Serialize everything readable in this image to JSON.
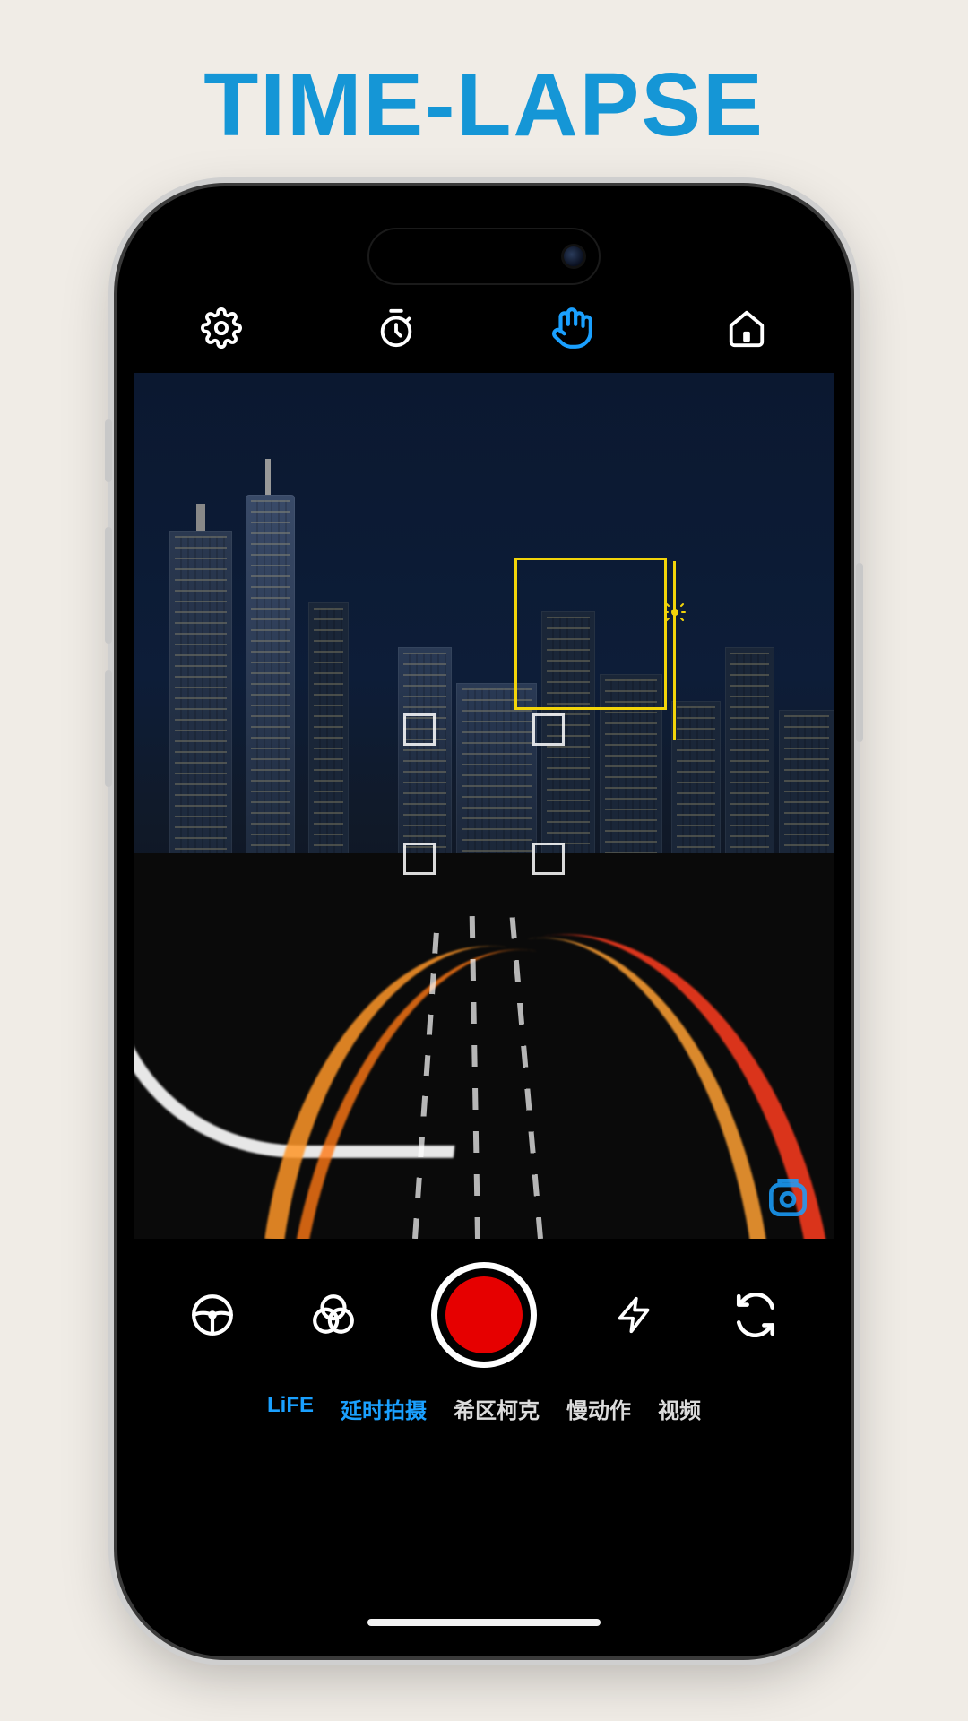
{
  "headline": "TIME-LAPSE",
  "colors": {
    "accent_blue": "#1aa0ff",
    "headline_blue": "#1596d6",
    "focus_yellow": "#f2d40a",
    "record_red": "#e60000"
  },
  "top_bar": {
    "icons": [
      "settings-icon",
      "timer-icon",
      "hand-icon",
      "home-icon"
    ],
    "active_icon": "hand-icon"
  },
  "bottom_controls": {
    "icons_left": [
      "steering-icon",
      "filter-icon"
    ],
    "shutter_icon": "record-button",
    "icons_right": [
      "flash-icon",
      "switch-camera-icon"
    ]
  },
  "modes": [
    {
      "label": "LiFE",
      "active": true
    },
    {
      "label": "延时拍摄",
      "active": true
    },
    {
      "label": "希区柯克",
      "active": false
    },
    {
      "label": "慢动作",
      "active": false
    },
    {
      "label": "视频",
      "active": false
    }
  ],
  "viewfinder": {
    "focus_indicator": "focus-square",
    "exposure_indicator": "sun-icon",
    "watermark_icon": "app-watermark"
  }
}
